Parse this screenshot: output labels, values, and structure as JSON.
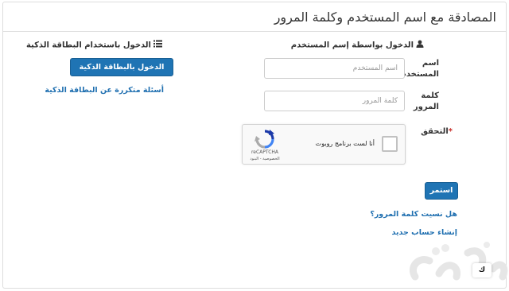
{
  "header": {
    "title": "المصادقة مع اسم المستخدم وكلمة المرور"
  },
  "username_login": {
    "heading": "الدخول بواسطة إسم المستخدم",
    "heading_icon": "user-icon",
    "username_label": "اسم المستخدم",
    "username_placeholder": "اسم المستخدم",
    "username_value": "",
    "password_label": "كلمة المرور",
    "password_placeholder": "كلمة المرور",
    "password_value": "",
    "verify_label": "التحقق",
    "required_mark": "*",
    "captcha": {
      "checkbox_text": "أنا لست برنامج روبوت",
      "brand": "reCAPTCHA",
      "terms": "الخصوصية - البنود",
      "checked": false
    },
    "continue_button": "استمر",
    "forgot_password_link": "هل نسيت كلمة المرور؟",
    "create_account_link": "إنشاء حساب جديد"
  },
  "smartcard_login": {
    "heading": "الدخول باستخدام البطاقة الذكية",
    "heading_icon": "list-icon",
    "login_button": "الدخول بالبطاقة الذكية",
    "faq_link": "أسئلة متكررة عن البطاقة الذكية"
  },
  "watermark": {
    "button_label": "ك"
  },
  "colors": {
    "primary_button": "#1f74b4",
    "link": "#1f6fb0",
    "required": "#c9302c",
    "border": "#dddddd"
  }
}
